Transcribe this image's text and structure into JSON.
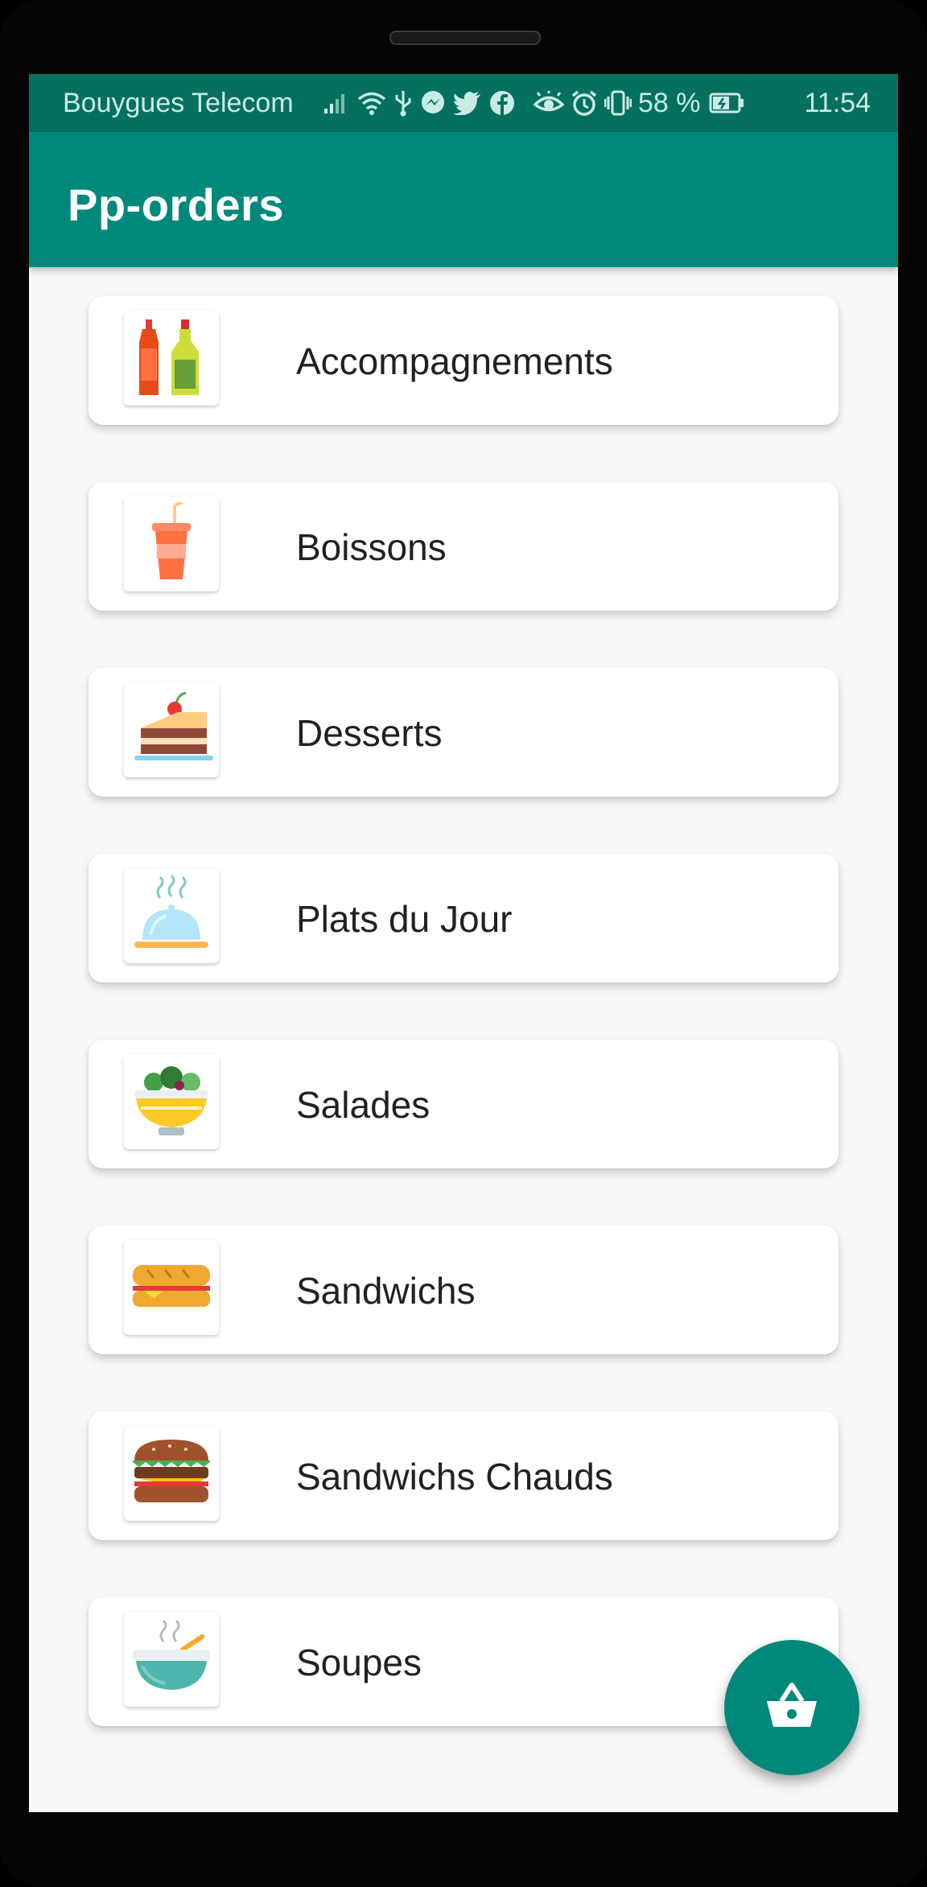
{
  "status_bar": {
    "carrier": "Bouygues Telecom",
    "battery": "58 %",
    "time": "11:54",
    "icons": [
      "signal-icon",
      "wifi-icon",
      "usb-icon",
      "messenger-icon",
      "twitter-icon",
      "facebook-icon",
      "eye-icon",
      "alarm-icon",
      "vibrate-icon",
      "battery-icon"
    ]
  },
  "app_bar": {
    "title": "Pp-orders"
  },
  "categories": [
    {
      "label": "Accompagnements",
      "icon": "condiment-bottles-icon"
    },
    {
      "label": "Boissons",
      "icon": "soda-cup-icon"
    },
    {
      "label": "Desserts",
      "icon": "cake-slice-icon"
    },
    {
      "label": "Plats du Jour",
      "icon": "cloche-plate-icon"
    },
    {
      "label": "Salades",
      "icon": "salad-bowl-icon"
    },
    {
      "label": "Sandwichs",
      "icon": "baguette-sandwich-icon"
    },
    {
      "label": "Sandwichs Chauds",
      "icon": "burger-icon"
    },
    {
      "label": "Soupes",
      "icon": "soup-bowl-icon"
    }
  ],
  "fab": {
    "icon": "basket-icon"
  },
  "colors": {
    "primary": "#00897b",
    "primary_dark": "#06705f",
    "background": "#f8f8f8"
  }
}
